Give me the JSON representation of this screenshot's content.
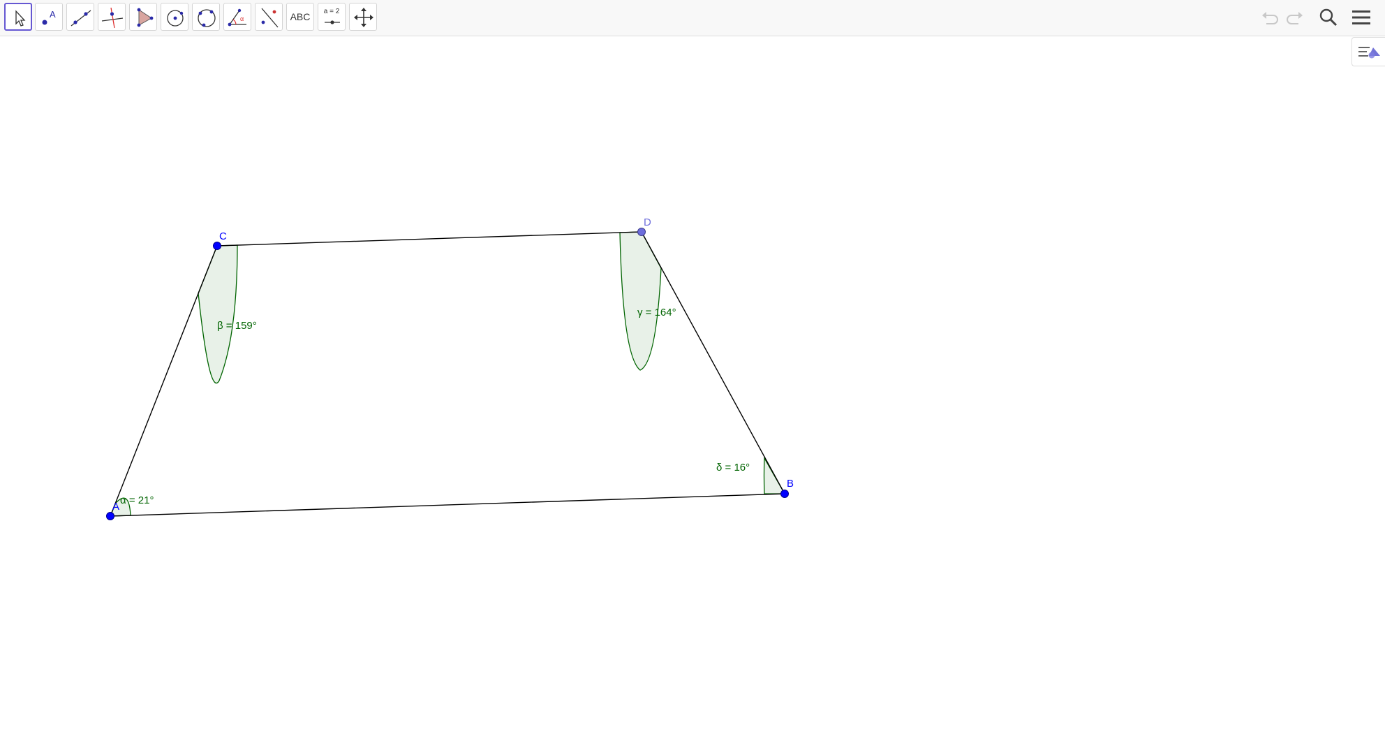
{
  "toolbar": {
    "tools": [
      {
        "name": "move-tool",
        "icon": "arrow-pointer-icon",
        "active": true
      },
      {
        "name": "point-tool",
        "icon": "point-icon",
        "label": "A"
      },
      {
        "name": "line-tool",
        "icon": "line-through-two-points-icon"
      },
      {
        "name": "perpendicular-line-tool",
        "icon": "perpendicular-line-icon"
      },
      {
        "name": "polygon-tool",
        "icon": "polygon-icon"
      },
      {
        "name": "circle-center-point-tool",
        "icon": "circle-center-icon"
      },
      {
        "name": "circle-three-points-tool",
        "icon": "circle-three-points-icon"
      },
      {
        "name": "angle-tool",
        "icon": "angle-icon",
        "label": "α"
      },
      {
        "name": "reflect-tool",
        "icon": "reflect-about-line-icon"
      },
      {
        "name": "text-tool",
        "icon": "text-icon",
        "label": "ABC"
      },
      {
        "name": "slider-tool",
        "icon": "slider-icon",
        "label": "a = 2"
      },
      {
        "name": "move-graphics-view-tool",
        "icon": "move-graphics-icon"
      }
    ],
    "right_buttons": [
      {
        "name": "undo-button",
        "icon": "undo-icon",
        "enabled": false
      },
      {
        "name": "redo-button",
        "icon": "redo-icon",
        "enabled": false
      },
      {
        "name": "search-button",
        "icon": "search-icon",
        "enabled": true
      },
      {
        "name": "main-menu-button",
        "icon": "hamburger-menu-icon",
        "enabled": true
      }
    ]
  },
  "algebra_toggle": {
    "icon": "algebra-view-icon"
  },
  "colors": {
    "point": "#0000ff",
    "point_free": "#6d6ddc",
    "segment": "#000000",
    "angle": "#006400",
    "angle_fill": "#e8f1e8",
    "active_tool_border": "#6557d2"
  },
  "graphics": {
    "points": [
      {
        "id": "A",
        "label": "A",
        "free": false
      },
      {
        "id": "B",
        "label": "B",
        "free": false
      },
      {
        "id": "C",
        "label": "C",
        "free": false
      },
      {
        "id": "D",
        "label": "D",
        "free": true
      }
    ],
    "segments": [
      {
        "from": "A",
        "to": "B"
      },
      {
        "from": "B",
        "to": "D"
      },
      {
        "from": "D",
        "to": "C"
      },
      {
        "from": "C",
        "to": "A"
      }
    ],
    "angles": [
      {
        "id": "alpha",
        "vertex": "A",
        "label": "α = 21°",
        "degrees": 21
      },
      {
        "id": "beta",
        "vertex": "C",
        "label": "β = 159°",
        "degrees": 159
      },
      {
        "id": "gamma",
        "vertex": "D",
        "label": "γ = 164°",
        "degrees": 164
      },
      {
        "id": "delta",
        "vertex": "B",
        "label": "δ = 16°",
        "degrees": 16
      }
    ]
  }
}
